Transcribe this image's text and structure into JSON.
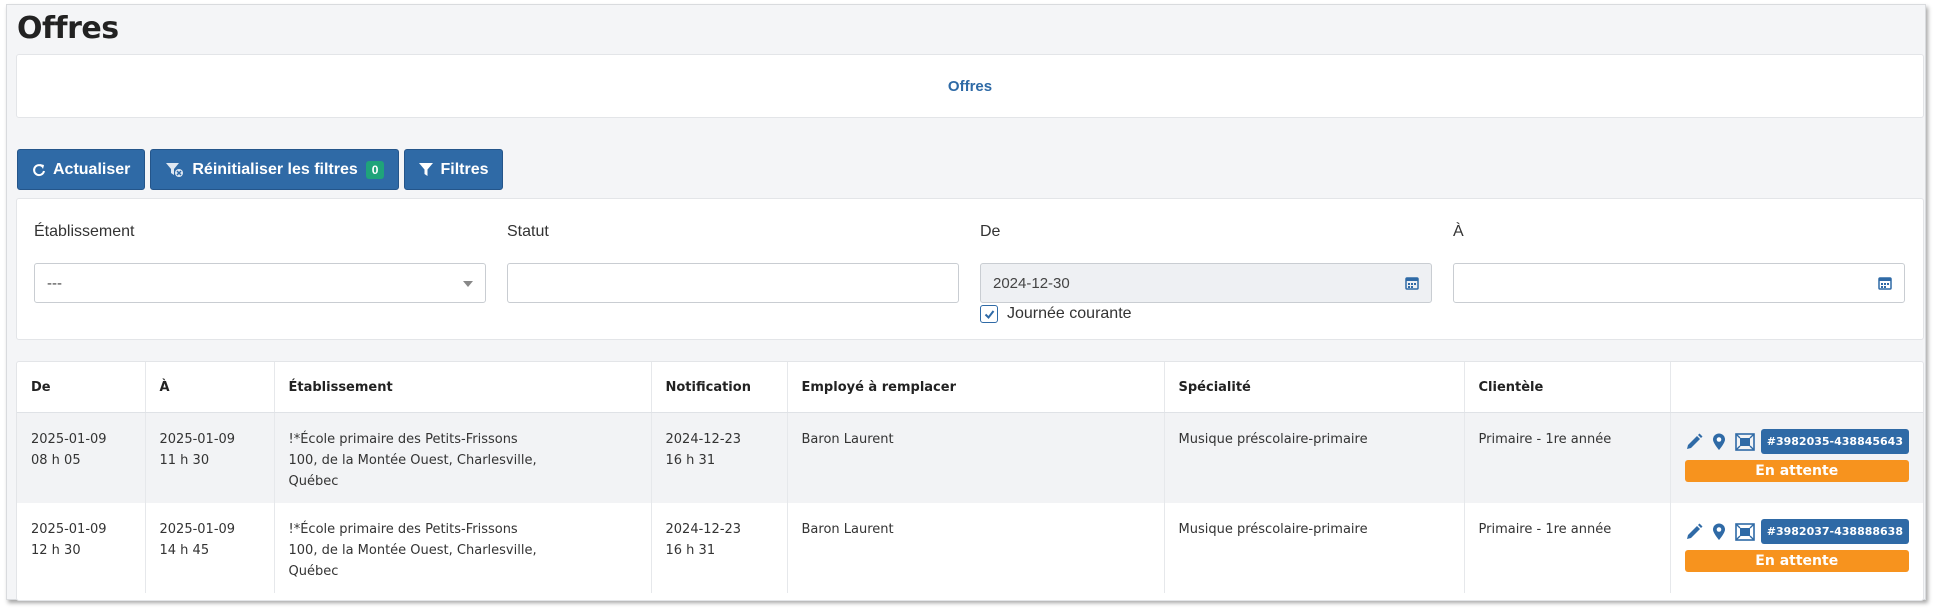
{
  "page": {
    "title": "Offres"
  },
  "banner": {
    "label": "Offres"
  },
  "toolbar": {
    "refresh_label": "Actualiser",
    "reset_label": "Réinitialiser les filtres",
    "reset_count": "0",
    "filters_label": "Filtres"
  },
  "filters": {
    "etablissement": {
      "label": "Établissement",
      "value": "---"
    },
    "statut": {
      "label": "Statut",
      "value": ""
    },
    "de": {
      "label": "De",
      "value": "2024-12-30",
      "checkbox_label": "Journée courante",
      "checked": true
    },
    "a": {
      "label": "À",
      "value": ""
    }
  },
  "table": {
    "columns": [
      "De",
      "À",
      "Établissement",
      "Notification",
      "Employé à remplacer",
      "Spécialité",
      "Clientèle",
      ""
    ],
    "rows": [
      {
        "de_date": "2025-01-09",
        "de_time": "08 h 05",
        "a_date": "2025-01-09",
        "a_time": "11 h 30",
        "etab_name": "!*École primaire des Petits-Frissons",
        "etab_addr1": "100, de la Montée Ouest, Charlesville,",
        "etab_addr2": "Québec",
        "notif_date": "2024-12-23",
        "notif_time": "16 h 31",
        "employe": "Baron Laurent",
        "specialite": "Musique préscolaire-primaire",
        "clientele": "Primaire - 1re année",
        "ref": "#3982035-438845643",
        "status": "En attente"
      },
      {
        "de_date": "2025-01-09",
        "de_time": "12 h 30",
        "a_date": "2025-01-09",
        "a_time": "14 h 45",
        "etab_name": "!*École primaire des Petits-Frissons",
        "etab_addr1": "100, de la Montée Ouest, Charlesville,",
        "etab_addr2": "Québec",
        "notif_date": "2024-12-23",
        "notif_time": "16 h 31",
        "employe": "Baron Laurent",
        "specialite": "Musique préscolaire-primaire",
        "clientele": "Primaire - 1re année",
        "ref": "#3982037-438888638",
        "status": "En attente"
      }
    ]
  },
  "colors": {
    "primary": "#2f6aa6",
    "badge_green": "#1fa37a",
    "status_orange": "#f7931e",
    "link_blue": "#2e6aa6"
  }
}
